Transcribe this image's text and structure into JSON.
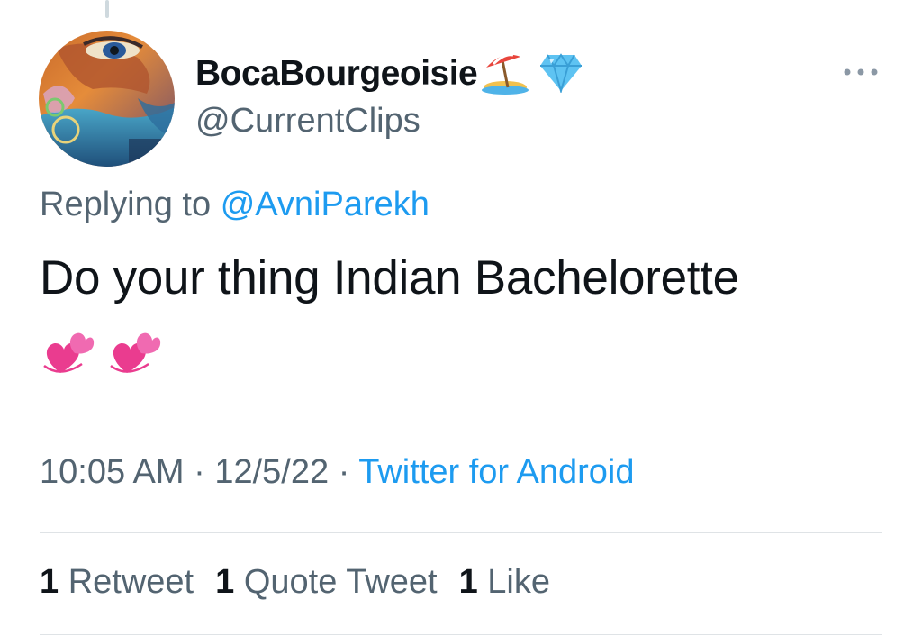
{
  "tweet": {
    "author": {
      "display_name": "BocaBourgeoisie",
      "handle": "@CurrentClips",
      "name_emojis": [
        "beach-umbrella-icon",
        "gem-icon"
      ]
    },
    "replying_prefix": "Replying to",
    "replying_to": "@AvniParekh",
    "text": "Do your thing Indian Bachelorette",
    "text_emojis": [
      "two-hearts-icon",
      "two-hearts-icon"
    ],
    "time": "10:05 AM",
    "separator": "·",
    "date": "12/5/22",
    "source": "Twitter for Android",
    "stats": [
      {
        "count": "1",
        "label": "Retweet"
      },
      {
        "count": "1",
        "label": "Quote Tweet"
      },
      {
        "count": "1",
        "label": "Like"
      }
    ]
  },
  "colors": {
    "text_primary": "#0f1419",
    "text_secondary": "#536471",
    "link": "#1d9bf0",
    "divider": "#dfe3e6"
  }
}
